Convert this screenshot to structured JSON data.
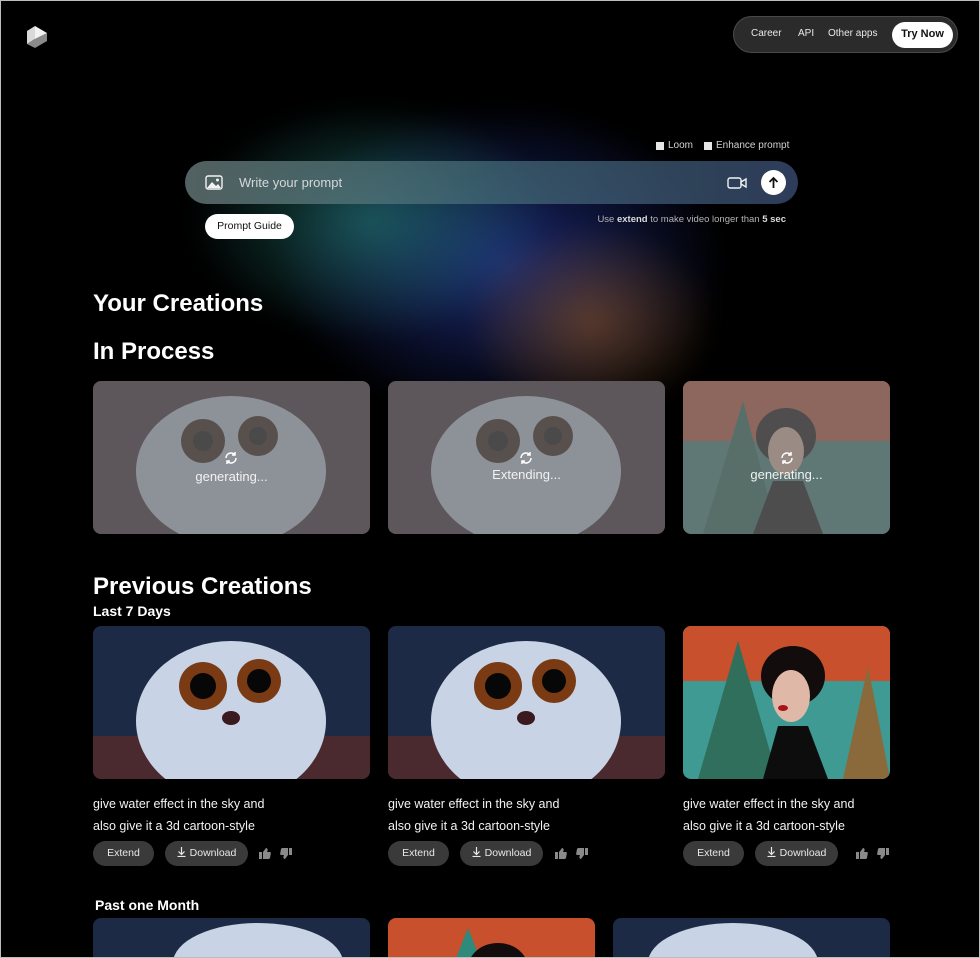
{
  "nav": {
    "links": [
      "Career",
      "API",
      "Other apps"
    ],
    "cta": "Try Now"
  },
  "prompt": {
    "options": [
      "Loom",
      "Enhance prompt"
    ],
    "placeholder": "Write your prompt",
    "hint_pre": "Use ",
    "hint_keyword": "extend",
    "hint_mid": " to make video longer than ",
    "hint_duration": "5 sec",
    "guide_button": "Prompt Guide"
  },
  "sections": {
    "creations_title": "Your Creations",
    "in_process_title": "In Process",
    "previous_title": "Previous Creations",
    "last7_title": "Last 7 Days",
    "past_month_title": "Past one Month"
  },
  "in_process": [
    {
      "status": "generating...",
      "image": "owl-creature"
    },
    {
      "status": "Extending...",
      "image": "owl-creature"
    },
    {
      "status": "generating...",
      "image": "woman-portrait"
    }
  ],
  "previous": [
    {
      "caption_line1": "give water effect in the sky and",
      "caption_line2": "also give it a 3d cartoon-style",
      "image": "owl-creature"
    },
    {
      "caption_line1": "give water effect in the sky and",
      "caption_line2": "also give it a 3d cartoon-style",
      "image": "owl-creature"
    },
    {
      "caption_line1": "give water effect in the sky and",
      "caption_line2": "also give it a 3d cartoon-style",
      "image": "woman-portrait"
    }
  ],
  "actions": {
    "extend": "Extend",
    "download": "Download"
  },
  "icons": {
    "logo": "cube-logo-icon",
    "image": "image-icon",
    "camera": "video-camera-icon",
    "send": "arrow-up-icon",
    "spinner": "refresh-icon",
    "download": "download-icon",
    "like": "thumbs-up-icon",
    "dislike": "thumbs-down-icon"
  }
}
